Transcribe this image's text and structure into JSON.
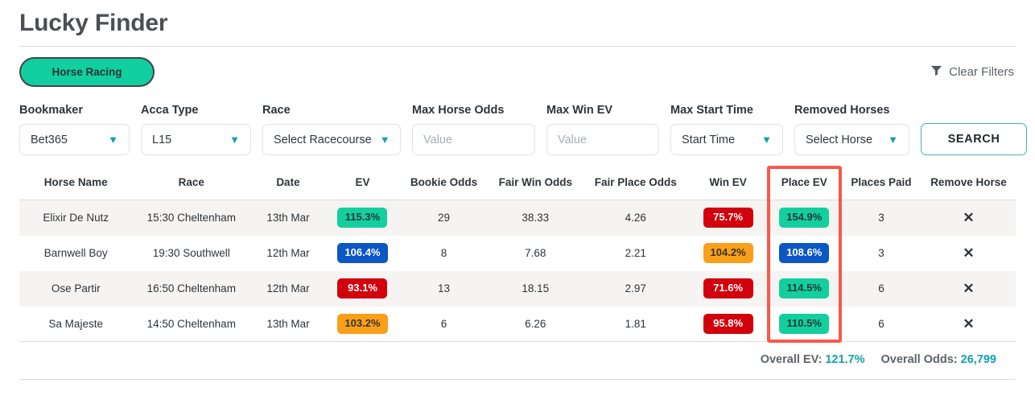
{
  "header": {
    "title": "Lucky Finder",
    "sport_pill": "Horse Racing",
    "clear_filters": "Clear Filters",
    "filter_icon": "funnel-icon"
  },
  "filters": [
    {
      "label": "Bookmaker",
      "value": "Bet365",
      "type": "select",
      "icon": "chevron-down-icon"
    },
    {
      "label": "Acca Type",
      "value": "L15",
      "type": "select",
      "icon": "chevron-down-icon"
    },
    {
      "label": "Race",
      "value": "Select Racecourse",
      "type": "select",
      "icon": "chevron-down-icon"
    },
    {
      "label": "Max Horse Odds",
      "placeholder": "Value",
      "value": "",
      "type": "input"
    },
    {
      "label": "Max Win EV",
      "placeholder": "Value",
      "value": "",
      "type": "input"
    },
    {
      "label": "Max Start Time",
      "value": "Start Time",
      "type": "select",
      "icon": "chevron-down-icon"
    },
    {
      "label": "Removed Horses",
      "value": "Select Horse",
      "type": "select",
      "icon": "chevron-down-icon"
    }
  ],
  "search_button": "SEARCH",
  "table": {
    "columns": [
      "Horse Name",
      "Race",
      "Date",
      "EV",
      "Bookie Odds",
      "Fair Win Odds",
      "Fair Place Odds",
      "Win EV",
      "Place EV",
      "Places Paid",
      "Remove Horse"
    ],
    "highlighted_column": "Place EV",
    "highlight_color": "#f9584c",
    "remove_icon": "close-x-icon",
    "rows": [
      {
        "horse_name": "Elixir De Nutz",
        "race": "15:30 Cheltenham",
        "date": "13th Mar",
        "ev": "115.3%",
        "ev_color": "green",
        "bookie_odds": "29",
        "fair_win_odds": "38.33",
        "fair_place_odds": "4.26",
        "win_ev": "75.7%",
        "win_ev_color": "red",
        "place_ev": "154.9%",
        "place_ev_color": "green",
        "places_paid": "3",
        "remove": "✕"
      },
      {
        "horse_name": "Barnwell Boy",
        "race": "19:30 Southwell",
        "date": "12th Mar",
        "ev": "106.4%",
        "ev_color": "blue",
        "bookie_odds": "8",
        "fair_win_odds": "7.68",
        "fair_place_odds": "2.21",
        "win_ev": "104.2%",
        "win_ev_color": "orange",
        "place_ev": "108.6%",
        "place_ev_color": "blue",
        "places_paid": "3",
        "remove": "✕"
      },
      {
        "horse_name": "Ose Partir",
        "race": "16:50 Cheltenham",
        "date": "12th Mar",
        "ev": "93.1%",
        "ev_color": "red",
        "bookie_odds": "13",
        "fair_win_odds": "18.15",
        "fair_place_odds": "2.97",
        "win_ev": "71.6%",
        "win_ev_color": "red",
        "place_ev": "114.5%",
        "place_ev_color": "green",
        "places_paid": "6",
        "remove": "✕"
      },
      {
        "horse_name": "Sa Majeste",
        "race": "14:50 Cheltenham",
        "date": "13th Mar",
        "ev": "103.2%",
        "ev_color": "orange",
        "bookie_odds": "6",
        "fair_win_odds": "6.26",
        "fair_place_odds": "1.81",
        "win_ev": "95.8%",
        "win_ev_color": "red",
        "place_ev": "110.5%",
        "place_ev_color": "green",
        "places_paid": "6",
        "remove": "✕"
      }
    ]
  },
  "totals": {
    "ev_label": "Overall EV:",
    "ev_value": "121.7%",
    "odds_label": "Overall Odds:",
    "odds_value": "26,799"
  },
  "colors": {
    "accent_green": "#13cf9e",
    "accent_teal": "#13a0b0",
    "badge_blue": "#0b57c4",
    "badge_red": "#d2000c",
    "badge_orange": "#f9a01b",
    "highlight_red": "#f9584c"
  }
}
